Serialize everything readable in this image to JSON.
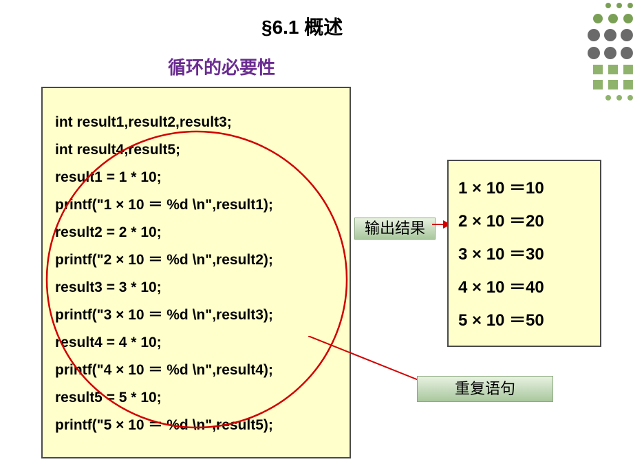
{
  "title": "§6.1  概述",
  "subtitle": "循环的必要性",
  "code": {
    "l1": "int result1,result2,result3;",
    "l2": "int result4,result5;",
    "l3": "result1 = 1 * 10;",
    "l4": "printf(\"1 × 10 ＝ %d \\n\",result1);",
    "l5": "result2 = 2 * 10;",
    "l6": "printf(\"2 × 10 ＝ %d \\n\",result2);",
    "l7": "result3 = 3 * 10;",
    "l8": "printf(\"3 × 10 ＝ %d \\n\",result3);",
    "l9": "result4 = 4 * 10;",
    "l10": "printf(\"4 × 10 ＝ %d \\n\",result4);",
    "l11": "result5 = 5 * 10;",
    "l12": "printf(\"5 × 10 ＝ %d \\n\",result5);"
  },
  "labels": {
    "output": "输出结果",
    "repeat": "重复语句"
  },
  "output": {
    "o1": "1 × 10 ＝10",
    "o2": "2 × 10 ＝20",
    "o3": "3 × 10 ＝30",
    "o4": "4 × 10 ＝40",
    "o5": "5 × 10 ＝50"
  }
}
